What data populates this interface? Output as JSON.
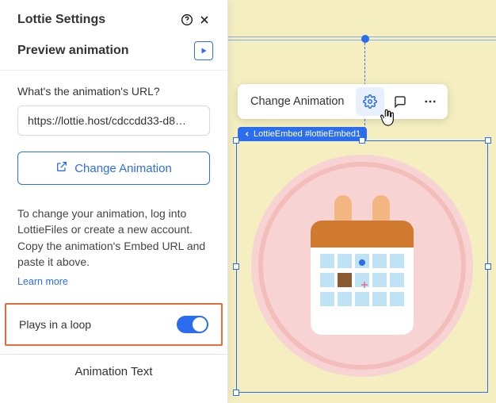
{
  "panel": {
    "title": "Lottie Settings",
    "preview_label": "Preview animation",
    "url_label": "What's the animation's URL?",
    "url_value": "https://lottie.host/cdccdd33-d8…",
    "change_btn": "Change Animation",
    "help_text": "To change your animation, log into LottieFiles or create a new account. Copy the animation's Embed URL and paste it above.",
    "learn_more": "Learn more",
    "loop_label": "Plays in a loop",
    "animation_text": "Animation Text"
  },
  "toolbar": {
    "change_animation": "Change Animation"
  },
  "element_badge": "LottieEmbed #lottieEmbed1"
}
